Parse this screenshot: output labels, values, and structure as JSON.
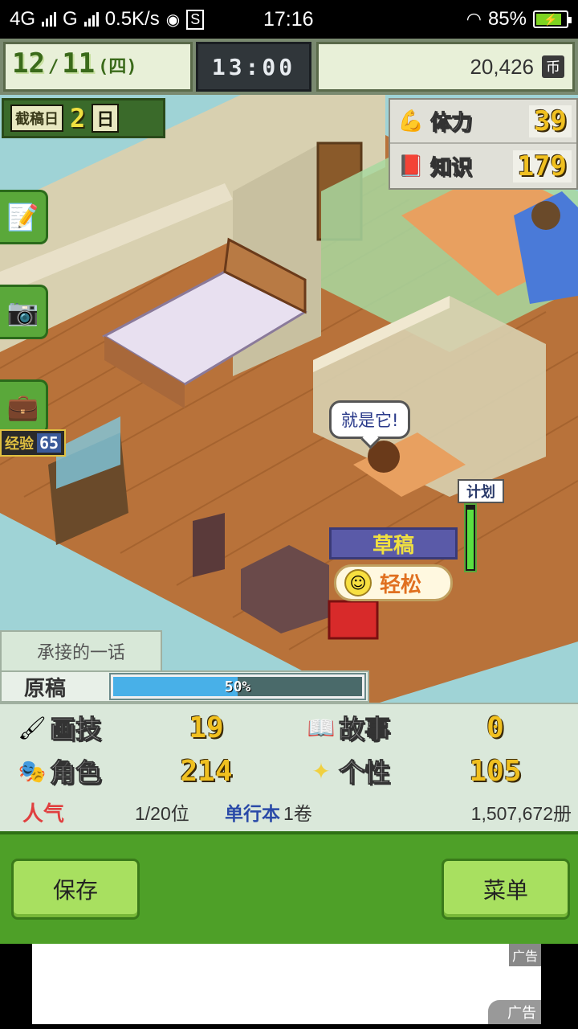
{
  "status_bar": {
    "network1": "4G",
    "network2": "G",
    "speed": "0.5K/s",
    "time": "17:16",
    "battery": "85%",
    "battery_level": 0.85
  },
  "hud": {
    "month": "12",
    "day": "11",
    "weekday": "(四)",
    "clock": "13:00",
    "money": "20,426",
    "money_unit": "币"
  },
  "deadline": {
    "label": "截稿日",
    "value": "2",
    "unit": "日"
  },
  "stats": [
    {
      "icon": "muscle-icon",
      "glyph": "💪",
      "name": "体力",
      "value": "39"
    },
    {
      "icon": "book-icon",
      "glyph": "📕",
      "name": "知识",
      "value": "179"
    }
  ],
  "side_buttons": [
    {
      "icon": "notebook-icon",
      "glyph": "📝"
    },
    {
      "icon": "camera-icon",
      "glyph": "📷"
    },
    {
      "icon": "briefcase-icon",
      "glyph": "💼"
    }
  ],
  "exp_tag": {
    "label": "经验",
    "value": "65"
  },
  "bubble_text": "就是它!",
  "plan": {
    "label": "计划",
    "level": 0.9
  },
  "task": "草稿",
  "mood": {
    "face": "☺",
    "label": "轻松"
  },
  "work": {
    "title": "承接的一话",
    "manuscript_label": "原稿",
    "progress": 0.5,
    "progress_text": "50%"
  },
  "attributes": [
    {
      "icon": "paint-icon",
      "glyph": "🖌",
      "name": "画技",
      "value": "19"
    },
    {
      "icon": "open-book-icon",
      "glyph": "📖",
      "name": "故事",
      "value": "0"
    },
    {
      "icon": "mask-icon",
      "glyph": "🎭",
      "name": "角色",
      "value": "214"
    },
    {
      "icon": "sparkle-icon",
      "glyph": "✦",
      "name": "个性",
      "value": "105"
    }
  ],
  "ranking": {
    "popularity_label": "人气",
    "rank": "1/20位",
    "volume_label": "单行本",
    "volume": "1卷",
    "sales": "1,507,672册"
  },
  "buttons": {
    "save": "保存",
    "menu": "菜单"
  },
  "ad": {
    "label": "广告"
  }
}
